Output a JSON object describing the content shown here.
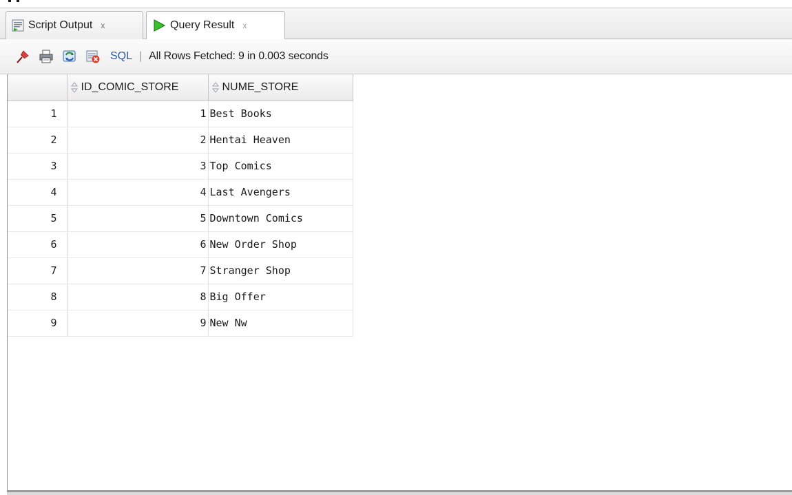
{
  "tabs": [
    {
      "label": "Script Output",
      "close": "x",
      "icon": "script-output-icon",
      "active": false
    },
    {
      "label": "Query Result",
      "close": "x",
      "icon": "run-triangle-icon",
      "active": true
    }
  ],
  "toolbar": {
    "icons": [
      "pin-icon",
      "print-icon",
      "refresh-sql-icon",
      "delete-row-icon"
    ],
    "sql_label": "SQL",
    "separator": "|",
    "status": "All Rows Fetched: 9 in 0.003 seconds"
  },
  "grid": {
    "columns": [
      "ID_COMIC_STORE",
      "NUME_STORE"
    ],
    "rows": [
      {
        "num": "1",
        "id": "1",
        "name": "Best Books"
      },
      {
        "num": "2",
        "id": "2",
        "name": "Hentai Heaven"
      },
      {
        "num": "3",
        "id": "3",
        "name": "Top Comics"
      },
      {
        "num": "4",
        "id": "4",
        "name": "Last Avengers"
      },
      {
        "num": "5",
        "id": "5",
        "name": "Downtown Comics"
      },
      {
        "num": "6",
        "id": "6",
        "name": "New Order Shop"
      },
      {
        "num": "7",
        "id": "7",
        "name": "Stranger Shop"
      },
      {
        "num": "8",
        "id": "8",
        "name": "Big Offer"
      },
      {
        "num": "9",
        "id": "9",
        "name": "New Nw"
      }
    ]
  },
  "colors": {
    "accent_green": "#2fae1f",
    "sql_link": "#2a5aa6",
    "pin_red": "#d22a2a"
  }
}
